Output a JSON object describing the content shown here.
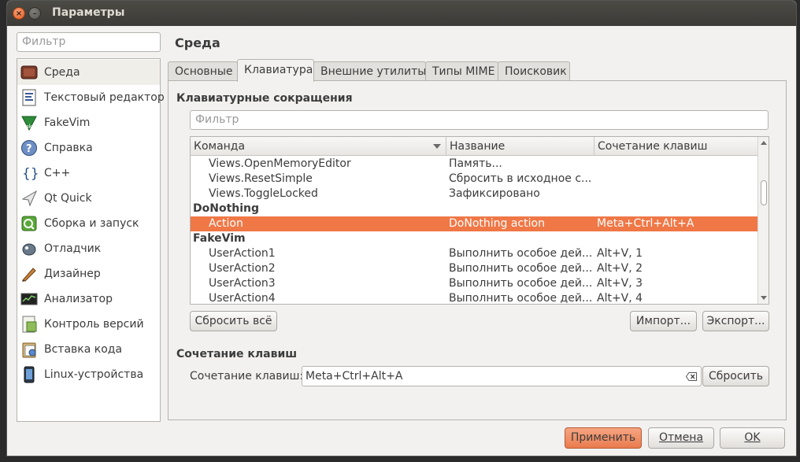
{
  "window": {
    "title": "Параметры"
  },
  "sidebar": {
    "filter_placeholder": "Фильтр",
    "items": [
      {
        "label": "Среда",
        "icon": "environment-icon"
      },
      {
        "label": "Текстовый редактор",
        "icon": "text-editor-icon"
      },
      {
        "label": "FakeVim",
        "icon": "fakevim-icon"
      },
      {
        "label": "Справка",
        "icon": "help-icon"
      },
      {
        "label": "C++",
        "icon": "cpp-icon"
      },
      {
        "label": "Qt Quick",
        "icon": "qt-quick-icon"
      },
      {
        "label": "Сборка и запуск",
        "icon": "build-run-icon"
      },
      {
        "label": "Отладчик",
        "icon": "debugger-icon"
      },
      {
        "label": "Дизайнер",
        "icon": "designer-icon"
      },
      {
        "label": "Анализатор",
        "icon": "analyzer-icon"
      },
      {
        "label": "Контроль версий",
        "icon": "version-control-icon"
      },
      {
        "label": "Вставка кода",
        "icon": "code-paste-icon"
      },
      {
        "label": "Linux-устройства",
        "icon": "linux-devices-icon"
      }
    ]
  },
  "main": {
    "title": "Среда",
    "tabs": [
      "Основные",
      "Клавиатура",
      "Внешние утилиты",
      "Типы MIME",
      "Поисковик"
    ],
    "shortcuts_group": "Клавиатурные сокращения",
    "filter_placeholder": "Фильтр",
    "columns": [
      "Команда",
      "Название",
      "Сочетание клавиш"
    ],
    "rows": [
      {
        "command": "Views.OpenMemoryEditor",
        "name": "Память...",
        "shortcut": ""
      },
      {
        "command": "Views.ResetSimple",
        "name": "Сбросить в исходное с...",
        "shortcut": ""
      },
      {
        "command": "Views.ToggleLocked",
        "name": "Зафиксировано",
        "shortcut": ""
      },
      {
        "command": "DoNothing",
        "name": "",
        "shortcut": "",
        "group": true
      },
      {
        "command": "Action",
        "name": "DoNothing action",
        "shortcut": "Meta+Ctrl+Alt+A",
        "selected": true
      },
      {
        "command": "FakeVim",
        "name": "",
        "shortcut": "",
        "group": true
      },
      {
        "command": "UserAction1",
        "name": "Выполнить особое дей...",
        "shortcut": "Alt+V, 1"
      },
      {
        "command": "UserAction2",
        "name": "Выполнить особое дей...",
        "shortcut": "Alt+V, 2"
      },
      {
        "command": "UserAction3",
        "name": "Выполнить особое дей...",
        "shortcut": "Alt+V, 3"
      },
      {
        "command": "UserAction4",
        "name": "Выполнить особое дей...",
        "shortcut": "Alt+V, 4"
      }
    ],
    "reset_all": "Сбросить всё",
    "import": "Импорт...",
    "export": "Экспорт...",
    "key_group": "Сочетание клавиш",
    "key_label": "Сочетание клавиш:",
    "key_value": "Meta+Ctrl+Alt+A",
    "reset": "Сбросить"
  },
  "footer": {
    "apply": "Применить",
    "cancel": "Отмена",
    "ok": "OK"
  },
  "colors": {
    "selection": "#f07746",
    "apply_button": "#ea7b4e",
    "titlebar": "#3f3e3a"
  }
}
